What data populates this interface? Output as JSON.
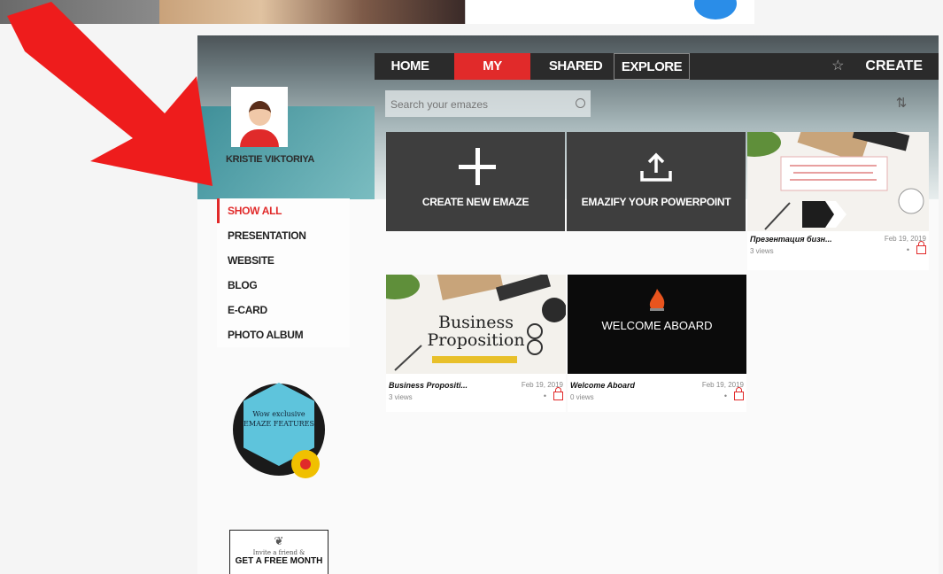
{
  "nav": {
    "tabs": [
      "HOME",
      "MY",
      "SHARED",
      "EXPLORE"
    ],
    "create_label": "CREATE"
  },
  "search": {
    "placeholder": "Search your emazes"
  },
  "profile": {
    "username": "KRISTIE VIKTORIYA"
  },
  "sidebar": {
    "items": [
      "SHOW ALL",
      "PRESENTATION",
      "WEBSITE",
      "BLOG",
      "E-CARD",
      "PHOTO ALBUM"
    ]
  },
  "tiles": {
    "create_label": "CREATE NEW EMAZE",
    "emazify_label": "EMAZIFY YOUR POWERPOINT"
  },
  "cards": [
    {
      "title": "Презентация бизн...",
      "date": "Feb 19, 2019",
      "views": "3 views"
    },
    {
      "title": "Business Propositi...",
      "date": "Feb 19, 2019",
      "views": "3 views",
      "thumb_line1": "Business",
      "thumb_line2": "Proposition"
    },
    {
      "title": "Welcome Aboard",
      "date": "Feb 19, 2019",
      "views": "0 views",
      "thumb_text": "WELCOME ABOARD"
    }
  ],
  "promo": {
    "circle_text": "Wow exclusive EMAZE FEATURES",
    "invite_small": "Invite a friend &",
    "invite_big": "GET A FREE MONTH"
  },
  "colors": {
    "accent": "#e12a2a",
    "nav_bg": "#2b2b2b",
    "tile_bg": "#3e3e3e"
  }
}
